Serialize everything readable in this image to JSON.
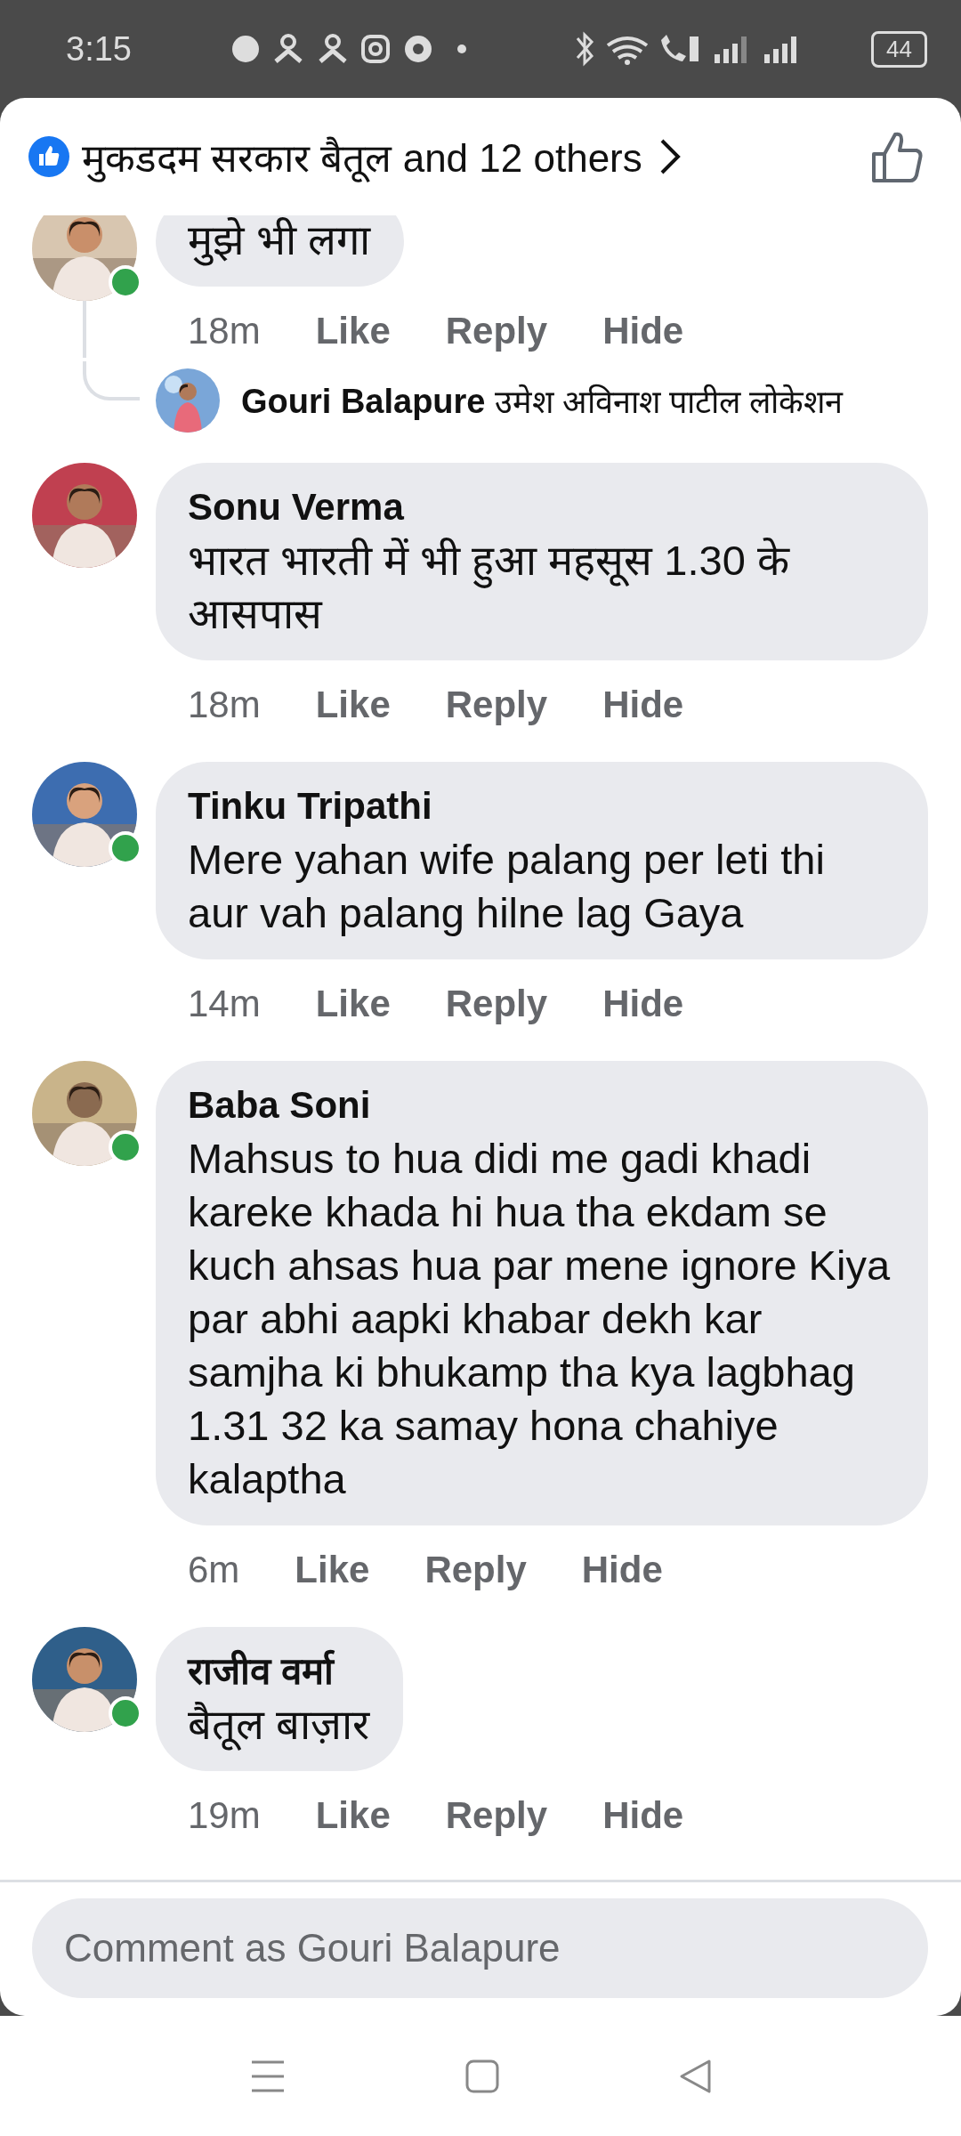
{
  "status_bar": {
    "time": "3:15",
    "battery": "44"
  },
  "header": {
    "reactors": "मुकडदम सरकार बैतूल and 12 others"
  },
  "comments": [
    {
      "text": "मुझे भी लगा",
      "online": true,
      "time": "18m",
      "actions": [
        "Like",
        "Reply",
        "Hide"
      ],
      "reply_preview": {
        "name": "Gouri Balapure",
        "text": "उमेश अविनाश पाटील लोकेशन"
      }
    },
    {
      "name": "Sonu Verma",
      "text": "भारत भारती में भी हुआ महसूस 1.30 के आसपास",
      "online": false,
      "time": "18m",
      "actions": [
        "Like",
        "Reply",
        "Hide"
      ]
    },
    {
      "name": "Tinku Tripathi",
      "text": "Mere yahan wife palang per leti thi aur vah palang hilne lag Gaya",
      "online": true,
      "time": "14m",
      "actions": [
        "Like",
        "Reply",
        "Hide"
      ]
    },
    {
      "name": "Baba Soni",
      "text": "Mahsus to hua didi me gadi khadi kareke khada hi hua tha ekdam se kuch ahsas hua par mene ignore Kiya par abhi aapki khabar dekh kar samjha ki bhukamp tha kya lagbhag 1.31 32 ka samay hona chahiye kalaptha",
      "online": true,
      "time": "6m",
      "actions": [
        "Like",
        "Reply",
        "Hide"
      ]
    },
    {
      "name": "राजीव वर्मा",
      "text": "बैतूल बाज़ार",
      "online": true,
      "time": "19m",
      "actions": [
        "Like",
        "Reply",
        "Hide"
      ]
    }
  ],
  "comment_field": {
    "placeholder": "Comment as Gouri Balapure"
  }
}
